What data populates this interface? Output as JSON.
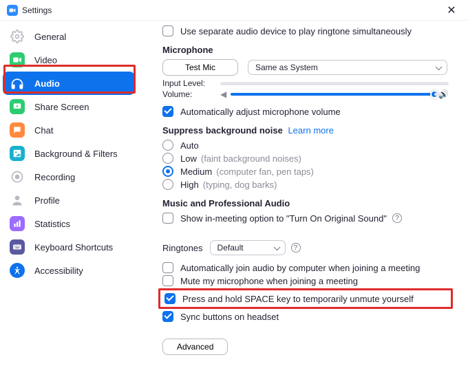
{
  "window": {
    "title": "Settings"
  },
  "sidebar": {
    "items": [
      {
        "label": "General",
        "icon": "gear"
      },
      {
        "label": "Video",
        "icon": "video"
      },
      {
        "label": "Audio",
        "icon": "headphones",
        "active": true
      },
      {
        "label": "Share Screen",
        "icon": "share"
      },
      {
        "label": "Chat",
        "icon": "chat"
      },
      {
        "label": "Background & Filters",
        "icon": "bg"
      },
      {
        "label": "Recording",
        "icon": "record"
      },
      {
        "label": "Profile",
        "icon": "profile"
      },
      {
        "label": "Statistics",
        "icon": "stats"
      },
      {
        "label": "Keyboard Shortcuts",
        "icon": "keyboard"
      },
      {
        "label": "Accessibility",
        "icon": "accessibility"
      }
    ]
  },
  "audio": {
    "separate_device_label": "Use separate audio device to play ringtone simultaneously",
    "mic_section": "Microphone",
    "test_mic_btn": "Test Mic",
    "mic_device": "Same as System",
    "input_level_label": "Input Level:",
    "volume_label": "Volume:",
    "auto_adjust_label": "Automatically adjust microphone volume",
    "suppress_section": "Suppress background noise",
    "learn_more": "Learn more",
    "suppress_options": {
      "auto": "Auto",
      "low": "Low",
      "low_hint": "(faint background noises)",
      "medium": "Medium",
      "medium_hint": "(computer fan, pen taps)",
      "high": "High",
      "high_hint": "(typing, dog barks)"
    },
    "music_section": "Music and Professional Audio",
    "original_sound_label": "Show in-meeting option to \"Turn On Original Sound\"",
    "ringtones_label": "Ringtones",
    "ringtones_value": "Default",
    "auto_join_label": "Automatically join audio by computer when joining a meeting",
    "mute_on_join_label": "Mute my microphone when joining a meeting",
    "space_unmute_label": "Press and hold SPACE key to temporarily unmute yourself",
    "sync_headset_label": "Sync buttons on headset",
    "advanced_btn": "Advanced"
  },
  "colors": {
    "accent": "#0E72ED",
    "highlight": "#E02B2B"
  }
}
